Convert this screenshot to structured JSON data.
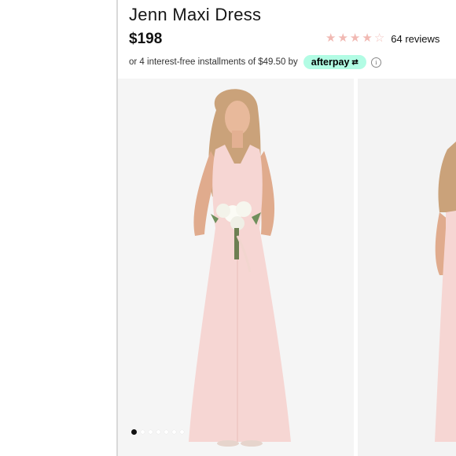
{
  "product": {
    "title": "Jenn Maxi Dress",
    "price": "$198"
  },
  "rating": {
    "value": 4,
    "max": 5,
    "reviews_label": "64 reviews"
  },
  "installments": {
    "text": "or 4 interest-free installments of $49.50 by",
    "provider": "afterpay",
    "provider_color": "#b2fce4"
  },
  "gallery": {
    "image_count": 7,
    "current_index": 0
  },
  "colors": {
    "star": "#f1b9b3",
    "dress": "#f6d6d3"
  }
}
